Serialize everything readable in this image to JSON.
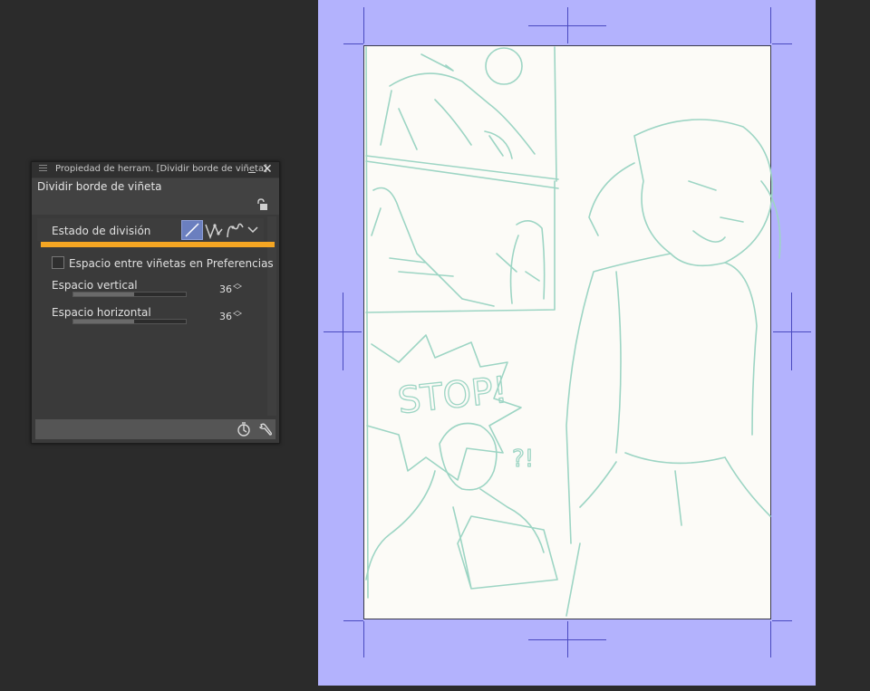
{
  "panel": {
    "title": "Propiedad de herram. [Dividir borde de viñeta]",
    "tool_name": "Dividir borde de viñeta",
    "division_label": "Estado de división",
    "division_modes": [
      "straight-line-icon",
      "polyline-icon",
      "curve-icon",
      "dropdown-arrow-icon"
    ],
    "selected_mode": "straight-line-icon",
    "gap_checkbox_label": "Espacio entre viñetas en Preferencias",
    "gap_checkbox_checked": false,
    "vertical": {
      "label": "Espacio vertical",
      "value": "36",
      "fill_fraction": 0.54
    },
    "horizontal": {
      "label": "Espacio horizontal",
      "value": "36",
      "fill_fraction": 0.54
    },
    "footer_icons": [
      "reset-icon",
      "settings-wrench-icon"
    ]
  },
  "canvas": {
    "sketch_text": "STOP!",
    "sketch_text_2": "?!"
  },
  "colors": {
    "canvas_background": "#b3b2fd",
    "paper": "#fcfbf7",
    "sketch_line": "#9dd5c4",
    "highlight": "#f5a623",
    "selected_mode": "#6b7fbf"
  }
}
